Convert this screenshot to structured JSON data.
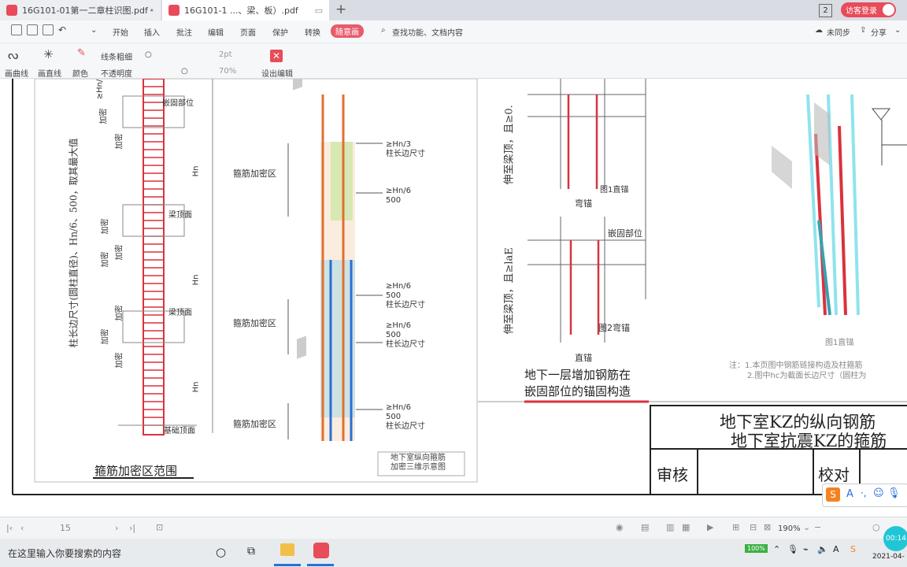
{
  "tabs": [
    {
      "label": "16G101-01第一二章柱识图.pdf",
      "close": "•"
    },
    {
      "label": "16G101-1 ...、梁、板）.pdf",
      "close": "▭"
    }
  ],
  "window": {
    "badge": "2",
    "login": "访客登录"
  },
  "menu": {
    "items": [
      "开始",
      "插入",
      "批注",
      "编辑",
      "页面",
      "保护",
      "转换",
      "随意画"
    ],
    "search": "查找功能、文档内容",
    "sync": "未同步",
    "share": "分享"
  },
  "draw_toolbar": {
    "curve": "画曲线",
    "line": "画直线",
    "color": "颜色",
    "thickness_label": "线条粗细",
    "opacity_label": "不透明度",
    "thickness_value": "2pt",
    "opacity_value": "70%",
    "exit": "设出编辑"
  },
  "drawing": {
    "left_caption": "箍筋加密区范围",
    "left_vertical_text": "柱长边尺寸(圆柱直径)、Hn/6、500，取其最大值",
    "left_labels": [
      "加密",
      "加密",
      "加密",
      "加密",
      "加密",
      "加密",
      "加密",
      "加密",
      "嵌固部位",
      "梁顶面",
      "梁顶面",
      "基础顶面",
      "Hn",
      "Hn",
      "Hn",
      "≥Hn/"
    ],
    "middle_labels": [
      "箍筋加密区",
      "箍筋加密区",
      "箍筋加密区"
    ],
    "middle_annotations": [
      [
        "≥Hn/3",
        "柱长边尺寸"
      ],
      [
        "≥Hn/6",
        "500"
      ],
      [
        "≥Hn/6",
        "500",
        "柱长边尺寸"
      ],
      [
        "≥Hn/6",
        "500",
        "柱长边尺寸"
      ],
      [
        "≥Hn/6",
        "500",
        "柱长边尺寸"
      ]
    ],
    "middle_caption": [
      "地下室纵向箍筋",
      "加密三维示意图"
    ],
    "right_vertical_labels": [
      "伸至梁顶，且≥0.",
      "伸至梁顶，且≥laE"
    ],
    "right_labels": [
      "图1直锚",
      "弯锚",
      "嵌固部位",
      "图2弯锚",
      "直锚"
    ],
    "right_caption": [
      "地下一层增加钢筋在",
      "嵌固部位的锚固构造"
    ],
    "far_right_label": "图1直锚",
    "notes": [
      "注：1.本页图中钢筋链接构造及柱箍筋",
      "2.图中hc为截面长边尺寸（圆柱为"
    ],
    "title_block": [
      "地下室KZ的纵向钢筋",
      "地下室抗震KZ的箍筋"
    ],
    "review": "审核",
    "proof": "校对"
  },
  "statusbar": {
    "page": "15",
    "zoom": "190%"
  },
  "taskbar": {
    "search": "在这里输入你要搜索的内容",
    "battery": "100%",
    "date": "2021-04-",
    "time": "00:14"
  }
}
